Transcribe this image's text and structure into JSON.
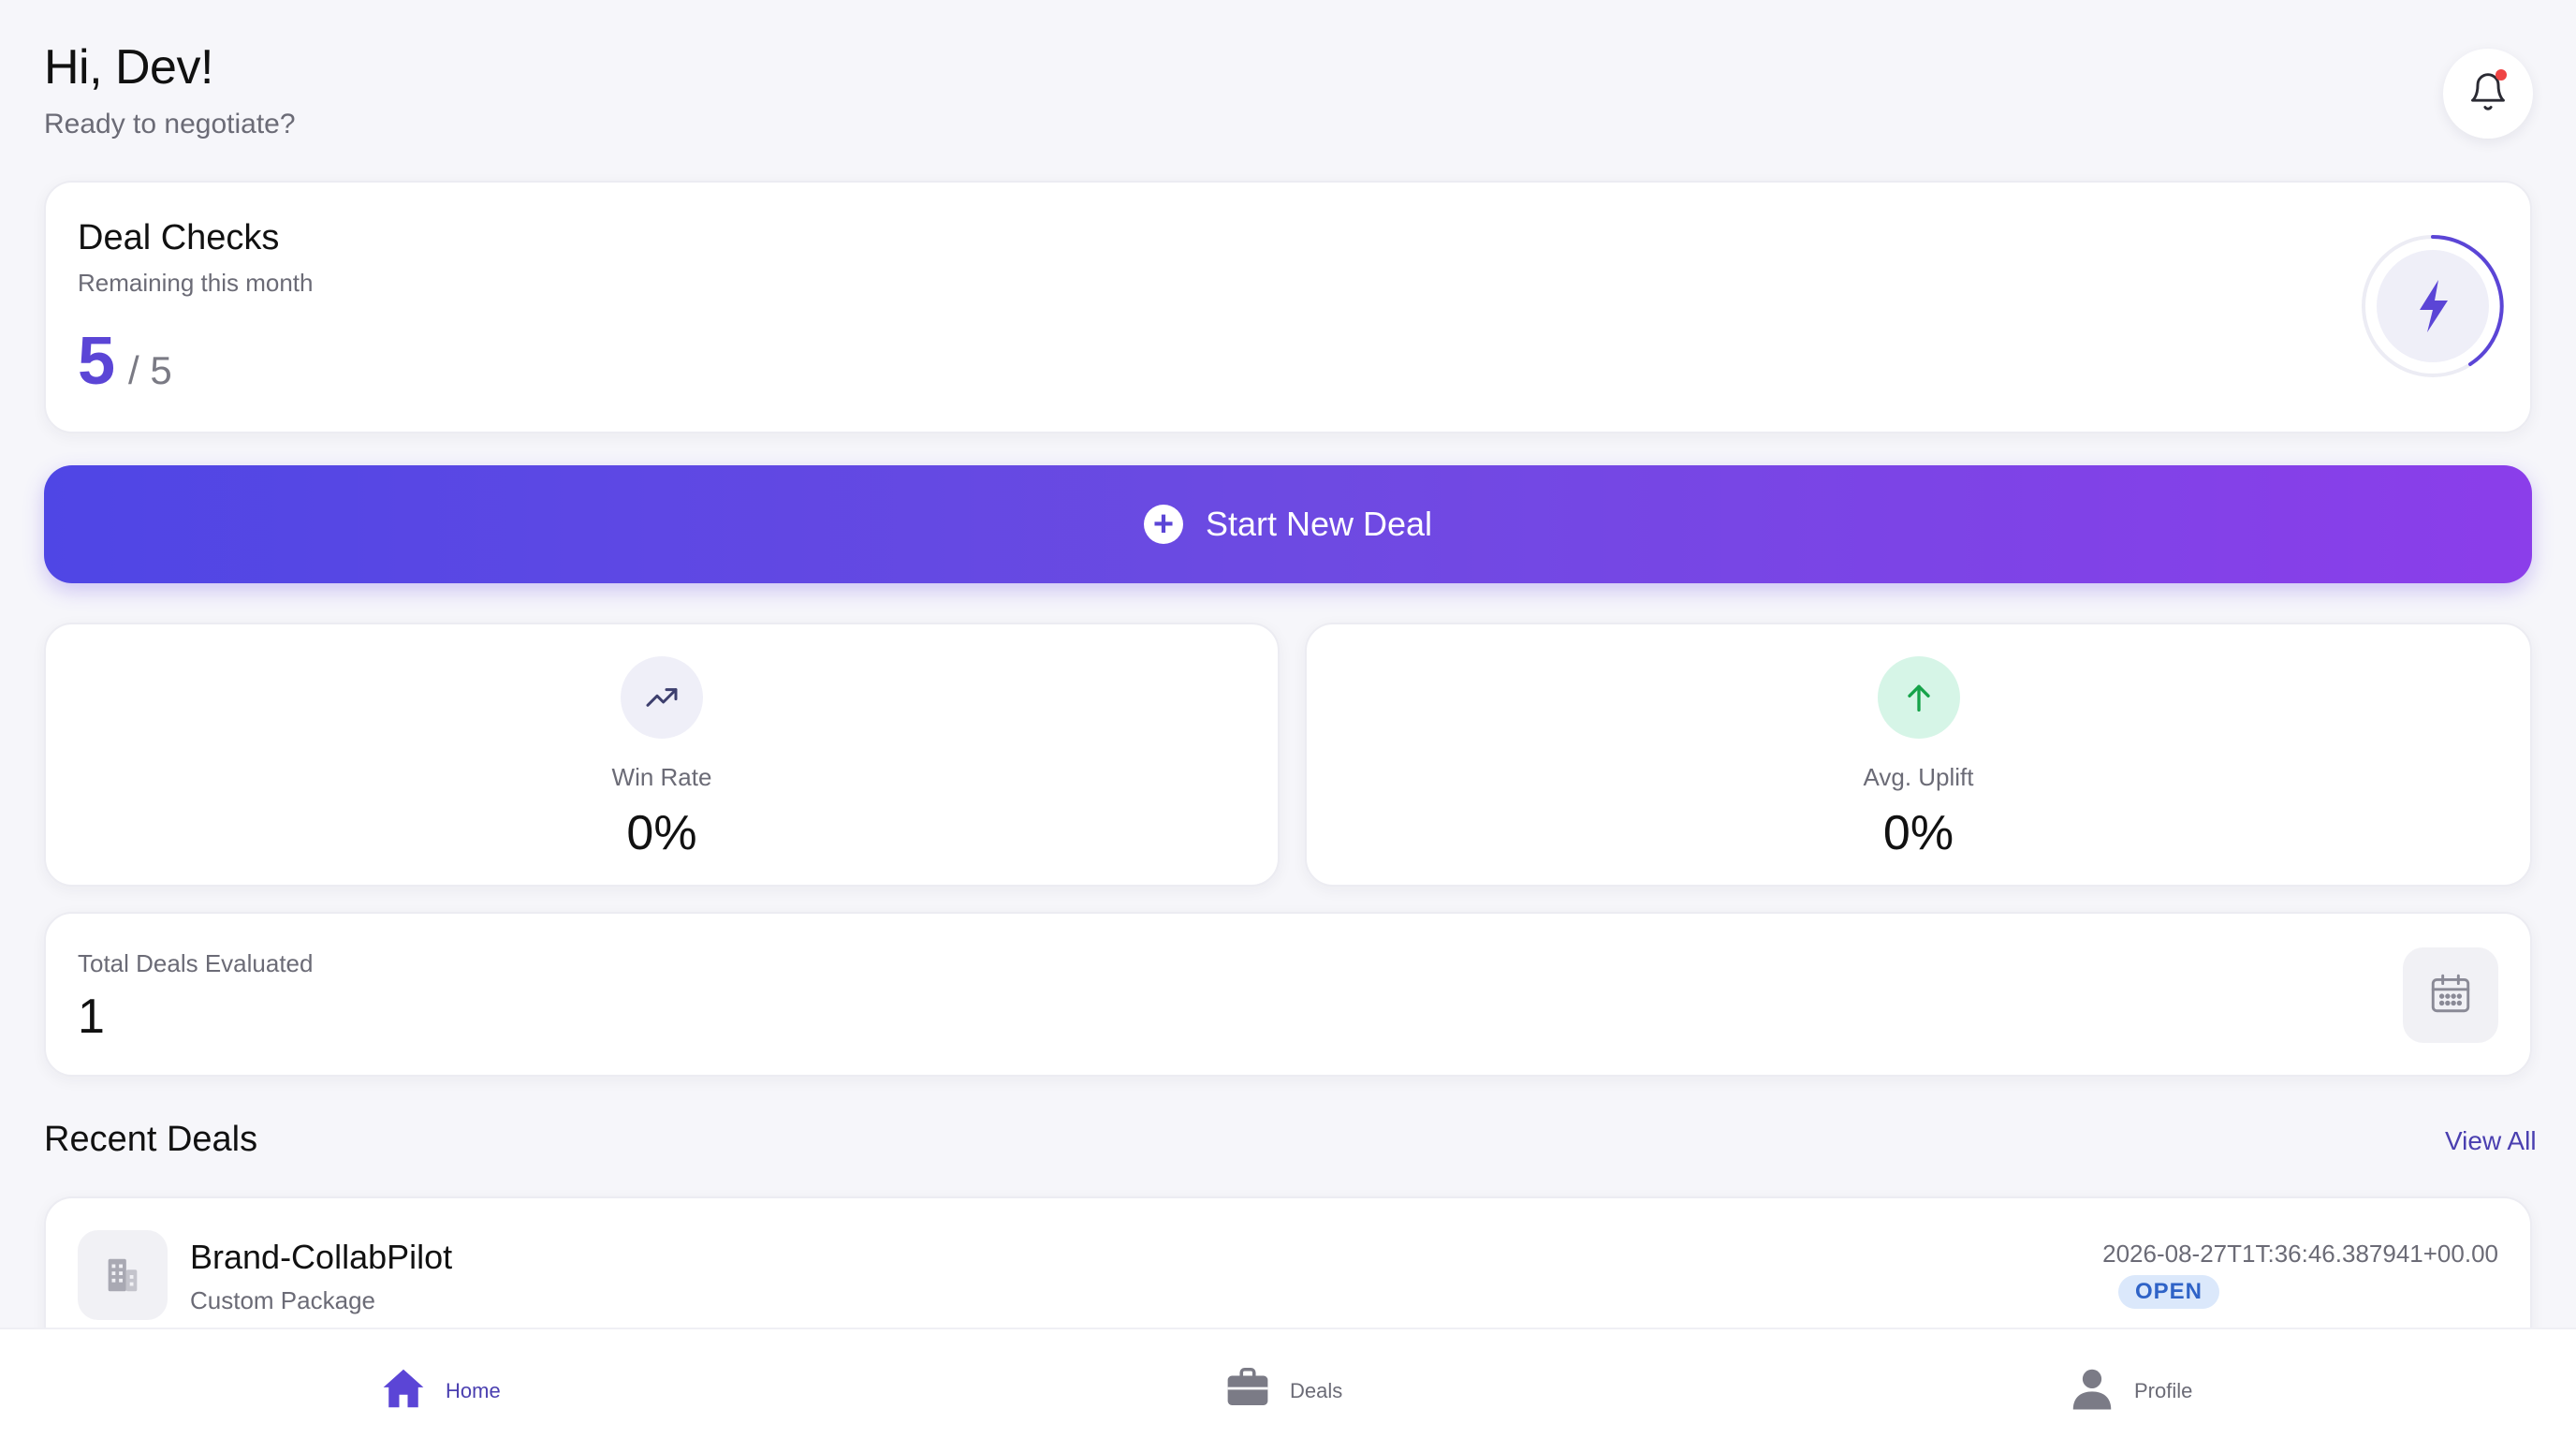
{
  "header": {
    "greeting": "Hi, Dev!",
    "subgreeting": "Ready to negotiate?"
  },
  "notifications": {
    "icon": "bell-icon",
    "has_unread": true
  },
  "deal_checks": {
    "title": "Deal Checks",
    "subtitle": "Remaining this month",
    "remaining": "5",
    "total": "/ 5",
    "icon": "lightning-icon"
  },
  "start_button": {
    "label": "Start New Deal",
    "icon": "plus-circle-icon"
  },
  "stats": {
    "win_rate": {
      "label": "Win Rate",
      "value": "0%",
      "icon": "trending-up-icon"
    },
    "avg_uplift": {
      "label": "Avg. Uplift",
      "value": "0%",
      "icon": "arrow-up-icon"
    }
  },
  "total_deals": {
    "label": "Total Deals Evaluated",
    "value": "1",
    "icon": "calendar-icon"
  },
  "recent": {
    "title": "Recent Deals",
    "view_all": "View All",
    "items": [
      {
        "name": "Brand-CollabPilot",
        "type": "Custom Package",
        "date": "2026-08-27T1T:36:46.387941+00.00",
        "status": "OPEN",
        "icon": "building-icon"
      }
    ]
  },
  "nav": {
    "items": [
      {
        "label": "Home",
        "icon": "home-icon",
        "active": true
      },
      {
        "label": "Deals",
        "icon": "briefcase-icon",
        "active": false
      },
      {
        "label": "Profile",
        "icon": "user-icon",
        "active": false
      }
    ]
  },
  "colors": {
    "accent": "#5b45d6",
    "gradient_start": "#4f46e5",
    "gradient_end": "#8b3eea",
    "success_bg": "#d6f5e7",
    "success": "#16a34a",
    "badge_bg": "#dbe8fb",
    "badge_text": "#2f63c7",
    "notification_dot": "#ef4444"
  }
}
